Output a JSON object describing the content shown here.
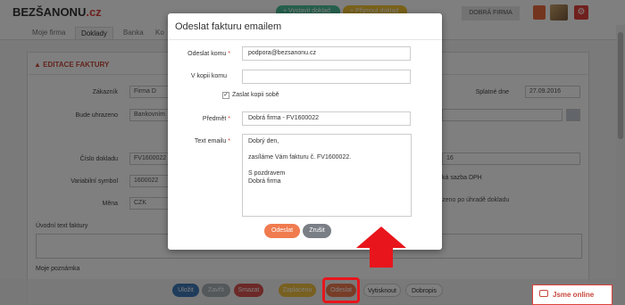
{
  "header": {
    "logo_main": "BEZŠANONU",
    "logo_suffix": ".cz",
    "new_doc_button": "+ Vystavit doklad",
    "receive_doc_button": "+ Přijmout doklad",
    "company": "DOBRÁ FIRMA"
  },
  "nav": {
    "tabs": [
      "Moje firma",
      "Doklady",
      "Banka",
      "Ko"
    ]
  },
  "form": {
    "title": "EDITACE FAKTURY",
    "customer_label": "Zákazník",
    "customer_value": "Firma D",
    "paid_by_label": "Bude uhrazeno",
    "paid_by_value": "Bankovním",
    "due_label": "Splatné dne",
    "due_value": "27.09.2016",
    "doc_number_label": "Číslo dokladu",
    "doc_number_value": "FV1600022",
    "doc_number_right": "16",
    "var_symbol_label": "Variabilní symbol",
    "var_symbol_value": "1600022",
    "vat_text": "ká sazba DPH",
    "currency_label": "Měna",
    "currency_value": "CZK",
    "after_pay_text": "razeno po úhradě dokladu",
    "intro_label": "Úvodní text faktury",
    "note_label": "Moje poznámka"
  },
  "toolbar": {
    "save": "Uložit",
    "close": "Zavřít",
    "delete": "Smazat",
    "paid": "Zaplaceno",
    "send": "Odeslat",
    "print": "Vytisknout",
    "credit": "Dobropis"
  },
  "chat": {
    "label": "Jsme online"
  },
  "modal": {
    "title": "Odeslat fakturu emailem",
    "to_label": "Odeslat komu",
    "to_value": "podpora@bezsanonu.cz",
    "cc_label": "V kopii komu",
    "cc_value": "",
    "copy_self_label": "Zaslat kopii sobě",
    "copy_self_checked": true,
    "subject_label": "Předmět",
    "subject_value": "Dobrá firma - FV1600022",
    "body_label": "Text emailu",
    "body_lines": [
      "Dobrý den,",
      "",
      "zasíláme Vám fakturu č. FV1600022.",
      "",
      "S pozdravem",
      "Dobrá firma"
    ],
    "send_button": "Odeslat",
    "cancel_button": "Zrušit"
  },
  "colors": {
    "accent_red": "#e0413a",
    "send_orange": "#f07b4f",
    "cancel_gray": "#7a7f86",
    "highlight": "#e8151c"
  }
}
